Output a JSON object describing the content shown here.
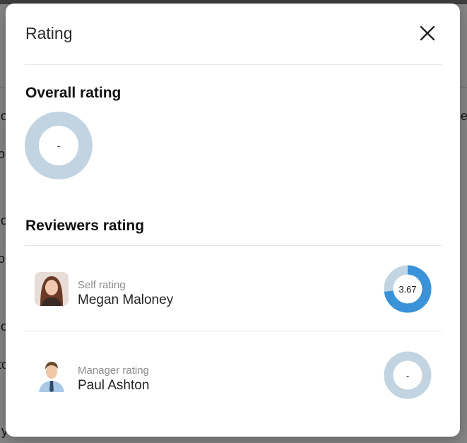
{
  "modal": {
    "title": "Rating",
    "overall": {
      "heading": "Overall rating",
      "value": "-",
      "fill": 0
    },
    "reviewers": {
      "heading": "Reviewers rating",
      "items": [
        {
          "role": "Self rating",
          "name": "Megan Maloney",
          "value": "3.67",
          "fill": 0.73
        },
        {
          "role": "Manager rating",
          "name": "Paul Ashton",
          "value": "-",
          "fill": 0
        }
      ]
    }
  },
  "colors": {
    "ring_track": "#c2d4e2",
    "ring_fill": "#3a92d8"
  },
  "background": {
    "fragments": [
      "lo",
      "o",
      "lo",
      "o",
      "lo",
      "to",
      "y",
      "e"
    ]
  }
}
